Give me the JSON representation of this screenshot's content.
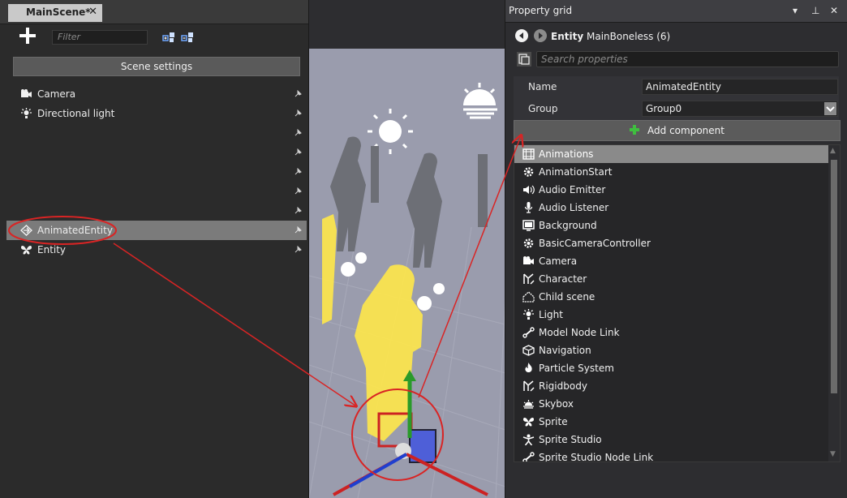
{
  "document_tab": {
    "title": "MainScene*",
    "close_glyph": "✕"
  },
  "scene_panel": {
    "filter_placeholder": "Filter",
    "scene_settings_label": "Scene settings",
    "entities": [
      {
        "label": "Camera",
        "icon": "camera-icon",
        "selected": false
      },
      {
        "label": "Directional light",
        "icon": "light-icon",
        "selected": false
      },
      {
        "label": "",
        "icon": "",
        "selected": false
      },
      {
        "label": "",
        "icon": "",
        "selected": false
      },
      {
        "label": "",
        "icon": "",
        "selected": false
      },
      {
        "label": "",
        "icon": "",
        "selected": false
      },
      {
        "label": "",
        "icon": "",
        "selected": false
      },
      {
        "label": "AnimatedEntity",
        "icon": "entity-icon",
        "selected": true
      },
      {
        "label": "Entity",
        "icon": "butterfly-icon",
        "selected": false
      }
    ]
  },
  "property_grid": {
    "title": "Property grid",
    "entity_type": "Entity",
    "entity_name": "MainBoneless (6)",
    "search_placeholder": "Search properties",
    "properties": [
      {
        "label": "Name",
        "value": "AnimatedEntity"
      },
      {
        "label": "Group",
        "value": "Group0"
      }
    ],
    "add_component_label": "Add component",
    "components": [
      "Animations",
      "AnimationStart",
      "Audio Emitter",
      "Audio Listener",
      "Background",
      "BasicCameraController",
      "Camera",
      "Character",
      "Child scene",
      "Light",
      "Model Node Link",
      "Navigation",
      "Particle System",
      "Rigidbody",
      "Skybox",
      "Sprite",
      "Sprite Studio",
      "Sprite Studio Node Link"
    ],
    "selected_component": "Animations"
  },
  "colors": {
    "annotation": "#d92424",
    "selection": "#7b7b7b",
    "add_green": "#3fbf3f",
    "viewport_bg": "#9a9cad",
    "highlight_yellow": "#ffe84a"
  }
}
